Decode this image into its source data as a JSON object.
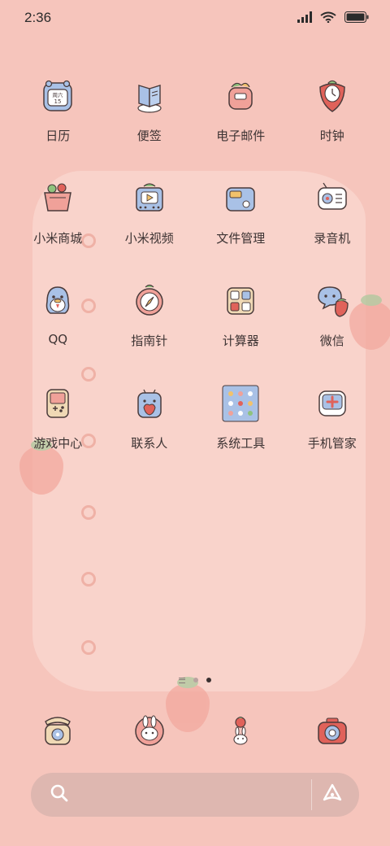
{
  "status_bar": {
    "time": "2:36"
  },
  "apps": [
    {
      "label": "日历",
      "icon": "calendar-icon",
      "calendar_weekday": "周六",
      "calendar_day": "15"
    },
    {
      "label": "便签",
      "icon": "notes-icon"
    },
    {
      "label": "电子邮件",
      "icon": "email-icon"
    },
    {
      "label": "时钟",
      "icon": "clock-icon"
    },
    {
      "label": "小米商城",
      "icon": "shop-icon"
    },
    {
      "label": "小米视频",
      "icon": "video-icon"
    },
    {
      "label": "文件管理",
      "icon": "folder-icon"
    },
    {
      "label": "录音机",
      "icon": "recorder-icon"
    },
    {
      "label": "QQ",
      "icon": "qq-penguin-icon"
    },
    {
      "label": "指南针",
      "icon": "compass-icon"
    },
    {
      "label": "计算器",
      "icon": "calculator-icon"
    },
    {
      "label": "微信",
      "icon": "wechat-icon"
    },
    {
      "label": "游戏中心",
      "icon": "game-console-icon"
    },
    {
      "label": "联系人",
      "icon": "contacts-icon"
    },
    {
      "label": "系统工具",
      "icon": "system-tools-folder-icon"
    },
    {
      "label": "手机管家",
      "icon": "security-icon"
    }
  ],
  "dock": [
    {
      "icon": "phone-icon"
    },
    {
      "icon": "messages-bunny-icon"
    },
    {
      "icon": "browser-bunny-icon"
    },
    {
      "icon": "camera-icon"
    }
  ],
  "page_indicator": {
    "pages": 2,
    "active": 2
  },
  "search_bar": {
    "placeholder": ""
  },
  "colors": {
    "wallpaper": "#f6c5bc",
    "accent_red": "#e0625a",
    "leaf_green": "#8fc27d",
    "icon_blue": "#a9c1e6"
  }
}
